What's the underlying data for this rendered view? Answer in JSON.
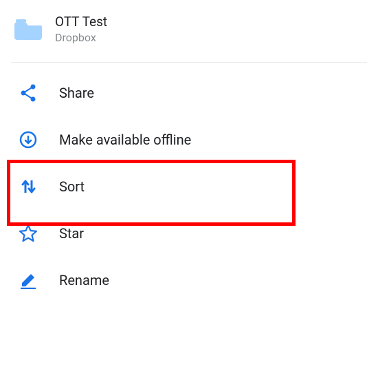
{
  "header": {
    "title": "OTT Test",
    "subtitle": "Dropbox"
  },
  "menu": {
    "share": "Share",
    "offline": "Make available offline",
    "sort": "Sort",
    "star": "Star",
    "rename": "Rename"
  },
  "colors": {
    "accent": "#1a73e8",
    "highlight": "#ff0000"
  }
}
